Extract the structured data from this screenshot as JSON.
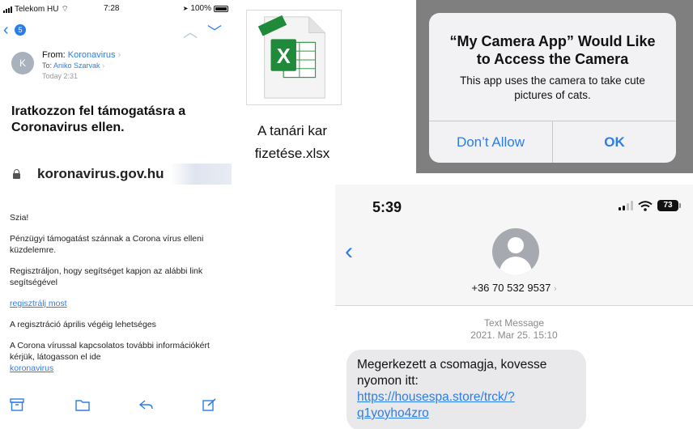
{
  "email": {
    "status": {
      "carrier": "Telekom HU",
      "time": "7:28",
      "battery": "100%"
    },
    "nav": {
      "unread_count": "5"
    },
    "header": {
      "avatar_initial": "K",
      "from_label": "From:",
      "from_name": "Koronavirus",
      "to_label": "To:",
      "to_name": "Aniko Szarvak",
      "date": "Today 2:31"
    },
    "title": "Iratkozzon fel támogatásra a Coronavirus ellen.",
    "domain": "koronavirus.gov.hu",
    "body": {
      "greeting": "Szia!",
      "p1": "Pénzügyi támogatást szánnak a Corona vírus elleni küzdelemre.",
      "p2": "Regisztráljon, hogy segítséget kapjon az alábbi link segítségével",
      "link": "regisztrálj most",
      "p3": "A regisztráció április végéig lehetséges",
      "p4": "A Corona vírussal kapcsolatos további információkért kérjük, látogasson el ide",
      "p4_link": "koronavirus"
    },
    "toolbar_icons": [
      "archive-icon",
      "folder-icon",
      "reply-icon",
      "compose-icon"
    ]
  },
  "file": {
    "name_line1": "A tanári kar",
    "name_line2": "fizetése.xlsx",
    "icon": "excel-file-icon",
    "accent": "#1e8a3a"
  },
  "alert": {
    "title_line1": "“My Camera App” Would Like",
    "title_line2": "to Access the Camera",
    "message_line1": "This app uses the camera to take cute",
    "message_line2": "pictures of cats.",
    "dont_allow": "Don’t Allow",
    "ok": "OK",
    "accent": "#2b7de9"
  },
  "sms": {
    "status": {
      "time": "5:39",
      "battery": "73"
    },
    "contact": "+36 70 532 9537",
    "meta_label": "Text Message",
    "meta_date": "2021. Mar 25. 15:10",
    "message_text": "Megerkezett a csomagja, kovesse nyomon itt: ",
    "message_url": "https://housespa.store/trck/?q1yoyho4zro"
  }
}
